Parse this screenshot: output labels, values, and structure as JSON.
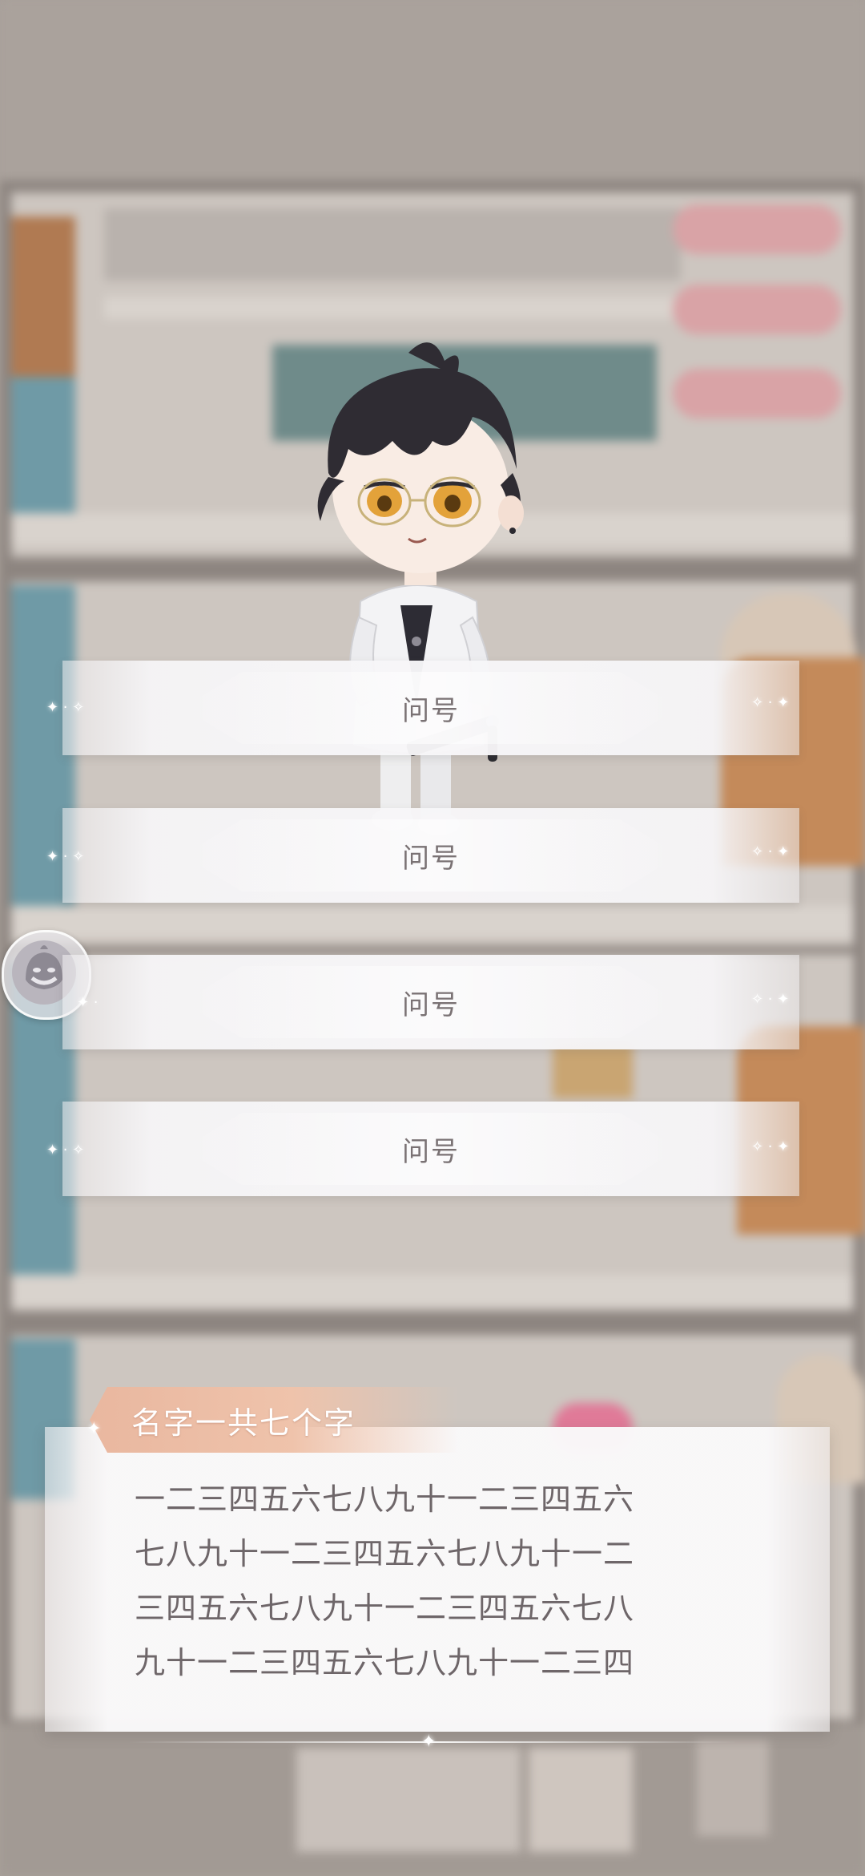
{
  "choices": [
    {
      "label": "问号"
    },
    {
      "label": "问号"
    },
    {
      "label": "问号"
    },
    {
      "label": "问号"
    }
  ],
  "dialogue": {
    "speaker": "名字一共七个字",
    "lines": [
      "一二三四五六七八九十一二三四五六",
      "七八九十一二三四五六七八九十一二",
      "三四五六七八九十一二三四五六七八",
      "九十一二三四五六七八九十一二三四"
    ]
  },
  "icons": {
    "emote_button": "smiling-ghost-icon",
    "sparkle": "sparkle-icon"
  },
  "colors": {
    "choice_text": "#7a7274",
    "name_tag": "#efc3ab",
    "dialog_text": "#6e6669"
  }
}
